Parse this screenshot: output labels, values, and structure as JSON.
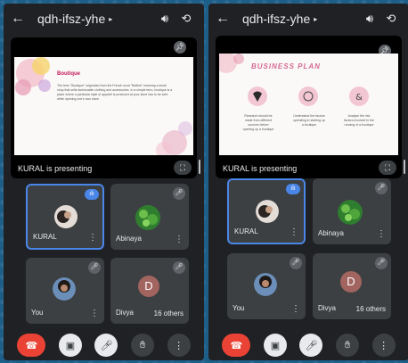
{
  "meeting": {
    "code": "qdh-ifsz-yhe",
    "presenter_label": "KURAL is presenting"
  },
  "slides": {
    "left": {
      "title": "Boutique",
      "body": "The term \"Boutique\" originated from the French word \"Bottine\" meaning a small shop that sells fashionable clothing and accessories. In a simple term, boutique is a place where a particular style of apparel is produced at your store has to be sent while opening one's own store."
    },
    "right": {
      "title": "BUSINESS PLAN",
      "items": [
        {
          "text": "Research should be made from different sources before opening up a boutique"
        },
        {
          "text": "Understand the factors operating in starting up a boutique"
        },
        {
          "text": "Analyse the risk factors involved in the running of a boutique"
        }
      ]
    }
  },
  "participants": [
    {
      "name": "KURAL",
      "state": "speaking"
    },
    {
      "name": "Abinaya",
      "state": "muted"
    },
    {
      "name": "You",
      "state": "muted"
    },
    {
      "name": "Divya",
      "state": "muted",
      "initial": "D",
      "others": "16 others"
    }
  ],
  "icons": {
    "back": "arrow-left-icon",
    "speaker": "speaker-icon",
    "switch_camera": "switch-camera-icon",
    "pin": "pin-icon",
    "fullscreen": "fullscreen-icon",
    "end_call": "end-call-icon",
    "camera_off": "camera-off-icon",
    "mic_off": "mic-off-icon",
    "raise_hand": "raise-hand-icon",
    "more": "more-options-icon"
  },
  "colors": {
    "end_call": "#ea4335",
    "active_border": "#4a86e8",
    "tile_bg": "#3c4043"
  }
}
